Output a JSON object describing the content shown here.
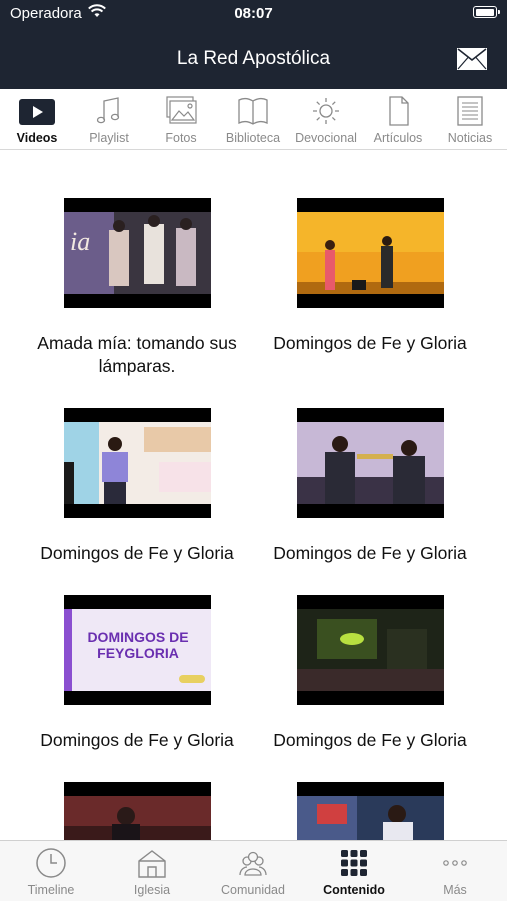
{
  "status_bar": {
    "carrier": "Operadora",
    "time": "08:07"
  },
  "header": {
    "title": "La Red Apostólica"
  },
  "tabs": [
    {
      "label": "Videos",
      "icon": "play-icon",
      "active": true
    },
    {
      "label": "Playlist",
      "icon": "music-note-icon",
      "active": false
    },
    {
      "label": "Fotos",
      "icon": "photos-icon",
      "active": false
    },
    {
      "label": "Biblioteca",
      "icon": "book-icon",
      "active": false
    },
    {
      "label": "Devocional",
      "icon": "sun-icon",
      "active": false
    },
    {
      "label": "Artículos",
      "icon": "document-icon",
      "active": false
    },
    {
      "label": "Noticias",
      "icon": "news-icon",
      "active": false
    }
  ],
  "videos": [
    {
      "title": "Amada mía: tomando sus lámparas."
    },
    {
      "title": "Domingos de Fe y Gloria"
    },
    {
      "title": "Domingos de Fe y Gloria"
    },
    {
      "title": "Domingos de Fe y Gloria"
    },
    {
      "title": "Domingos de Fe y Gloria",
      "thumb_text": "DOMINGOS DE FEYGLORIA"
    },
    {
      "title": "Domingos de Fe y Gloria"
    },
    {
      "title": ""
    },
    {
      "title": ""
    }
  ],
  "bottom_tabs": [
    {
      "label": "Timeline",
      "icon": "clock-icon",
      "active": false
    },
    {
      "label": "Iglesia",
      "icon": "church-icon",
      "active": false
    },
    {
      "label": "Comunidad",
      "icon": "community-icon",
      "active": false
    },
    {
      "label": "Contenido",
      "icon": "grid-icon",
      "active": true
    },
    {
      "label": "Más",
      "icon": "more-icon",
      "active": false
    }
  ],
  "colors": {
    "header_bg": "#1e2532",
    "active_tab": "#111111",
    "inactive_tab": "#8a8a8a"
  }
}
